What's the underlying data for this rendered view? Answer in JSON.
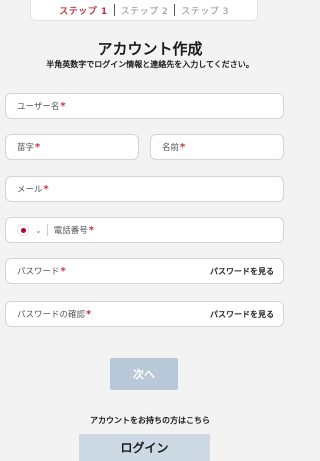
{
  "stepper": {
    "steps": [
      {
        "label": "ステップ 1",
        "active": true
      },
      {
        "label": "ステップ 2",
        "active": false
      },
      {
        "label": "ステップ 3",
        "active": false
      }
    ]
  },
  "header": {
    "title": "アカウント作成",
    "subtitle": "半角英数字でログイン情報と連絡先を入力してください。"
  },
  "form": {
    "required_mark": "*",
    "username": {
      "placeholder": "ユーザー名"
    },
    "last_name": {
      "placeholder": "苗字"
    },
    "first_name": {
      "placeholder": "名前"
    },
    "email": {
      "placeholder": "メール"
    },
    "phone": {
      "placeholder": "電話番号",
      "country_flag": "jp-flag-icon"
    },
    "password": {
      "placeholder": "パスワード",
      "show_label": "パスワードを見る"
    },
    "password_confirm": {
      "placeholder": "パスワードの確認",
      "show_label": "パスワードを見る"
    }
  },
  "actions": {
    "next_label": "次へ",
    "login_prompt": "アカウントをお持ちの方はこちら",
    "login_label": "ログイン"
  },
  "colors": {
    "accent_required": "#c8323f",
    "button_disabled": "#b9c9d9",
    "button_login": "#ccd9e5",
    "background": "#f3f3f3"
  }
}
